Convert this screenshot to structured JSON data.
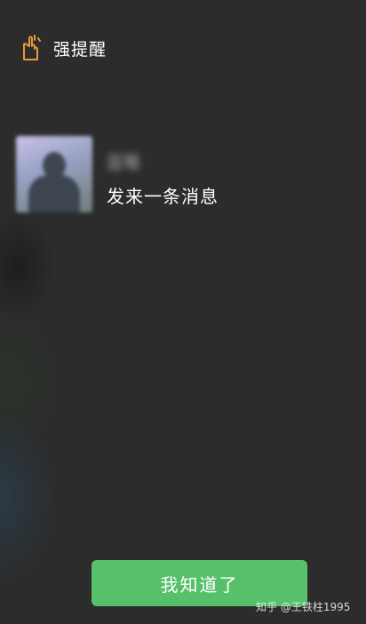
{
  "header": {
    "icon": "alert-hand-icon",
    "title": "强提醒",
    "icon_color": "#e39a3b"
  },
  "notification": {
    "sender_name": "蓝莓",
    "message": "发来一条消息"
  },
  "ack_button": {
    "label": "我知道了",
    "color": "#57c06a"
  },
  "watermark": {
    "text": "知乎 @王铁柱1995"
  }
}
